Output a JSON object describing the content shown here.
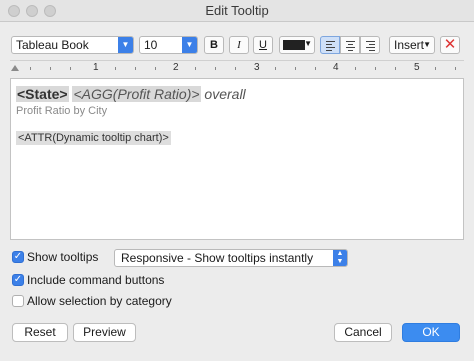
{
  "window": {
    "title": "Edit Tooltip"
  },
  "toolbar": {
    "font_family": "Tableau Book",
    "font_size": "10",
    "bold": "B",
    "italic": "I",
    "underline": "U",
    "text_color": "#222222",
    "insert_label": "Insert",
    "clear_label": "✕"
  },
  "ruler": {
    "numbers": [
      "1",
      "2",
      "3",
      "4",
      "5"
    ]
  },
  "editor": {
    "state_field": "<State>",
    "agg_field": "<AGG(Profit Ratio)>",
    "overall": " overall",
    "subtitle": "Profit Ratio by City",
    "viz_field": "<ATTR(Dynamic tooltip chart)>"
  },
  "options": {
    "show_tooltips": {
      "label": "Show tooltips",
      "checked": true
    },
    "tooltip_mode": "Responsive - Show tooltips instantly",
    "include_command_buttons": {
      "label": "Include command buttons",
      "checked": true
    },
    "allow_selection": {
      "label": "Allow selection by category",
      "checked": false
    }
  },
  "buttons": {
    "reset": "Reset",
    "preview": "Preview",
    "cancel": "Cancel",
    "ok": "OK"
  },
  "colors": {
    "accent": "#3c80e8",
    "primary_button": "#3c8cf0",
    "clear_icon": "#dd3333"
  }
}
